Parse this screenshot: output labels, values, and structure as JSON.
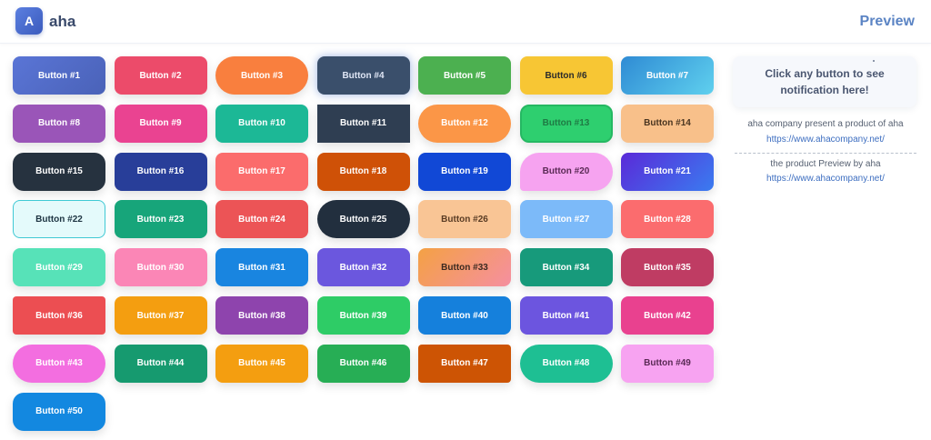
{
  "header": {
    "logo_letter": "A",
    "app_name": "aha",
    "preview_label": "Preview"
  },
  "notification": {
    "line1": "Click any button to see",
    "line2": "notification here!"
  },
  "info": {
    "credit_text": "aha company present a product of aha",
    "credit_link": "https://www.ahacompany.net/",
    "preview_text": "the product Preview by aha",
    "preview_link": "https://www.ahacompany.net/"
  },
  "buttons": [
    {
      "label": "Button #1",
      "bg": "linear-gradient(135deg,#5a75d6,#4a62b8)",
      "color": "#ffffff",
      "shape": "rounded"
    },
    {
      "label": "Button #2",
      "bg": "#ec4b6a",
      "color": "#ffffff",
      "shape": "rounded"
    },
    {
      "label": "Button #3",
      "bg": "#f97f3e",
      "color": "#ffffff",
      "shape": "pill"
    },
    {
      "label": "Button #4",
      "bg": "#3a4f6b",
      "color": "#dfe6f5",
      "shape": "rounded-glow"
    },
    {
      "label": "Button #5",
      "bg": "#4cb050",
      "color": "#ffffff",
      "shape": "rounded"
    },
    {
      "label": "Button #6",
      "bg": "#f7c634",
      "color": "#2b2b2b",
      "shape": "rounded"
    },
    {
      "label": "Button #7",
      "bg": "linear-gradient(135deg,#2f8bd4,#5fd0ee)",
      "color": "#ffffff",
      "shape": "rounded"
    },
    {
      "label": "Button #8",
      "bg": "#9a55b8",
      "color": "#ffffff",
      "shape": "rounded"
    },
    {
      "label": "Button #9",
      "bg": "#ea4391",
      "color": "#ffffff",
      "shape": "rounded"
    },
    {
      "label": "Button #10",
      "bg": "#1cb896",
      "color": "#ffffff",
      "shape": "rounded"
    },
    {
      "label": "Button #11",
      "bg": "#2f3e52",
      "color": "#ffffff",
      "shape": "square"
    },
    {
      "label": "Button #12",
      "bg": "#fb9647",
      "color": "#ffffff",
      "shape": "pill"
    },
    {
      "label": "Button #13",
      "bg": "#2ecf6f",
      "color": "#1f7a44",
      "shape": "rounded-border"
    },
    {
      "label": "Button #14",
      "bg": "#f8c08a",
      "color": "#4a3520",
      "shape": "rounded"
    },
    {
      "label": "Button #15",
      "bg": "#26323f",
      "color": "#ffffff",
      "shape": "rounded-lg"
    },
    {
      "label": "Button #16",
      "bg": "#283e99",
      "color": "#ffffff",
      "shape": "rounded"
    },
    {
      "label": "Button #17",
      "bg": "#fb6c6c",
      "color": "#ffffff",
      "shape": "rounded"
    },
    {
      "label": "Button #18",
      "bg": "#cf5107",
      "color": "#ffffff",
      "shape": "rounded"
    },
    {
      "label": "Button #19",
      "bg": "#1148d6",
      "color": "#ffffff",
      "shape": "rounded"
    },
    {
      "label": "Button #20",
      "bg": "#f6a3f0",
      "color": "#5a2a55",
      "shape": "leaf"
    },
    {
      "label": "Button #21",
      "bg": "linear-gradient(135deg,#5a2ad8,#3a7bf0)",
      "color": "#ffffff",
      "shape": "rounded"
    },
    {
      "label": "Button #22",
      "bg": "#e4fafb",
      "color": "#1d3442",
      "shape": "outline"
    },
    {
      "label": "Button #23",
      "bg": "#17a57a",
      "color": "#ffffff",
      "shape": "rounded"
    },
    {
      "label": "Button #24",
      "bg": "#ec5456",
      "color": "#ffffff",
      "shape": "rounded"
    },
    {
      "label": "Button #25",
      "bg": "#222f3e",
      "color": "#ffffff",
      "shape": "pill"
    },
    {
      "label": "Button #26",
      "bg": "#f9c595",
      "color": "#5a3c24",
      "shape": "rounded"
    },
    {
      "label": "Button #27",
      "bg": "#7cbaf9",
      "color": "#ffffff",
      "shape": "rounded"
    },
    {
      "label": "Button #28",
      "bg": "#fb6c6e",
      "color": "#ffffff",
      "shape": "rounded"
    },
    {
      "label": "Button #29",
      "bg": "#57e2b8",
      "color": "#ffffff",
      "shape": "rounded"
    },
    {
      "label": "Button #30",
      "bg": "#fb86b6",
      "color": "#ffffff",
      "shape": "rounded"
    },
    {
      "label": "Button #31",
      "bg": "#1985e0",
      "color": "#ffffff",
      "shape": "rounded"
    },
    {
      "label": "Button #32",
      "bg": "#6b57de",
      "color": "#ffffff",
      "shape": "rounded"
    },
    {
      "label": "Button #33",
      "bg": "linear-gradient(135deg,#f4a144,#f58fa0)",
      "color": "#3b2a20",
      "shape": "rounded"
    },
    {
      "label": "Button #34",
      "bg": "#179a7b",
      "color": "#ffffff",
      "shape": "rounded"
    },
    {
      "label": "Button #35",
      "bg": "#bf3c63",
      "color": "#ffffff",
      "shape": "rounded-lg"
    },
    {
      "label": "Button #36",
      "bg": "#ec4e52",
      "color": "#ffffff",
      "shape": "rounded-sm"
    },
    {
      "label": "Button #37",
      "bg": "#f49e10",
      "color": "#ffffff",
      "shape": "rounded"
    },
    {
      "label": "Button #38",
      "bg": "#8e44ad",
      "color": "#ffffff",
      "shape": "rounded"
    },
    {
      "label": "Button #39",
      "bg": "#2ecc66",
      "color": "#ffffff",
      "shape": "rounded"
    },
    {
      "label": "Button #40",
      "bg": "#1580dc",
      "color": "#ffffff",
      "shape": "rounded"
    },
    {
      "label": "Button #41",
      "bg": "#6c55df",
      "color": "#ffffff",
      "shape": "rounded"
    },
    {
      "label": "Button #42",
      "bg": "#e9418f",
      "color": "#ffffff",
      "shape": "rounded"
    },
    {
      "label": "Button #43",
      "bg": "#f36ee0",
      "color": "#ffffff",
      "shape": "pill"
    },
    {
      "label": "Button #44",
      "bg": "#169a6f",
      "color": "#ffffff",
      "shape": "rounded"
    },
    {
      "label": "Button #45",
      "bg": "#f49e10",
      "color": "#ffffff",
      "shape": "rounded"
    },
    {
      "label": "Button #46",
      "bg": "#27ae55",
      "color": "#ffffff",
      "shape": "rounded"
    },
    {
      "label": "Button #47",
      "bg": "#cd5404",
      "color": "#ffffff",
      "shape": "rounded-sm"
    },
    {
      "label": "Button #48",
      "bg": "#1ebf93",
      "color": "#ffffff",
      "shape": "pill"
    },
    {
      "label": "Button #49",
      "bg": "#f7a3f1",
      "color": "#5a2a55",
      "shape": "rounded"
    },
    {
      "label": "Button #50",
      "bg": "#1388e0",
      "color": "#ffffff",
      "shape": "rounded-lg"
    }
  ]
}
